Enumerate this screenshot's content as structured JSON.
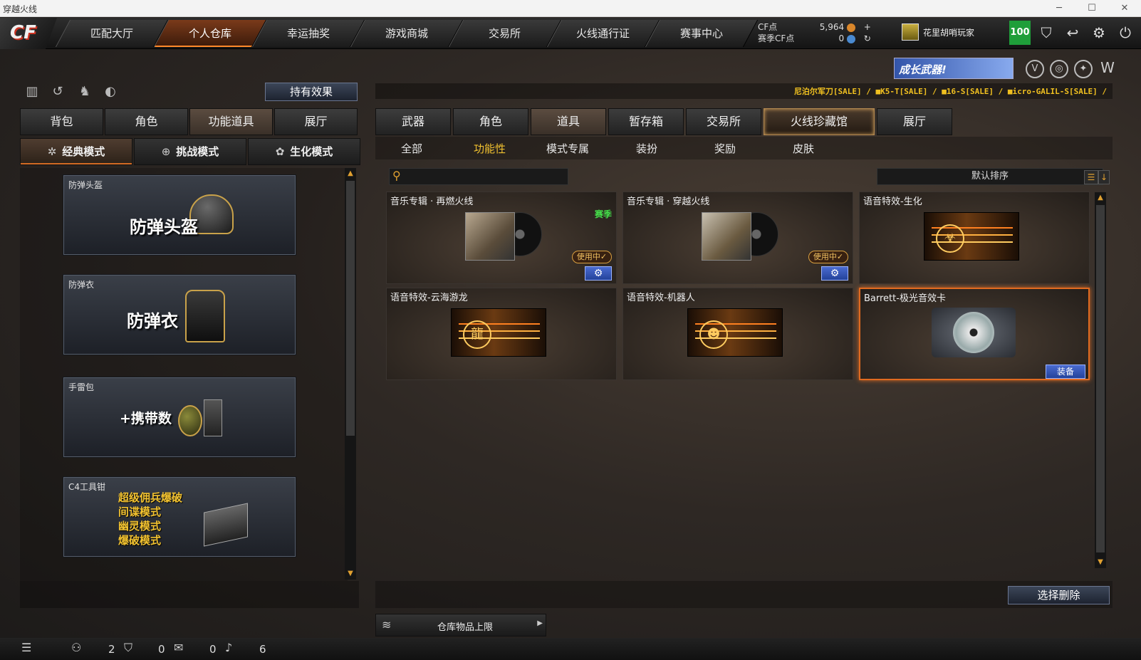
{
  "window": {
    "title": "穿越火线",
    "controls": [
      "─",
      "☐",
      "✕"
    ]
  },
  "nav": {
    "logo": "CF",
    "tabs": [
      "匹配大厅",
      "个人仓库",
      "幸运抽奖",
      "游戏商城",
      "交易所",
      "火线通行证",
      "赛事中心"
    ],
    "active": 1
  },
  "currency": {
    "cf_label": "CF点",
    "cf_value": "5,964",
    "season_label": "赛季CF点",
    "season_value": "0"
  },
  "player": {
    "name": "花里胡哨玩家",
    "level_badge": "100"
  },
  "promo": {
    "text": "成长武器!"
  },
  "left": {
    "effect_button": "持有效果",
    "tabs": [
      "背包",
      "角色",
      "功能道具",
      "展厅"
    ],
    "active_tab": 2,
    "modes": [
      "经典模式",
      "挑战模式",
      "生化模式"
    ],
    "active_mode": 0,
    "items": [
      {
        "label": "防弹头盔",
        "title": "防弹头盔"
      },
      {
        "label": "防弹衣",
        "title": "防弹衣"
      },
      {
        "label": "手雷包",
        "title": "+携带数"
      },
      {
        "label": "C4工具钳",
        "lines": [
          "超级佣兵爆破",
          "间谍模式",
          "幽灵模式",
          "爆破模式"
        ]
      }
    ]
  },
  "right": {
    "ticker": "尼泊尔军刀[SALE] / ■K5-T[SALE] / ■16-S[SALE] / ■icro-GALIL-S[SALE] /",
    "tabs": [
      "武器",
      "角色",
      "道具",
      "暂存箱",
      "交易所",
      "火线珍藏馆",
      "展厅"
    ],
    "active_tab": 2,
    "highlight_tab": 5,
    "subtabs": [
      "全部",
      "功能性",
      "模式专属",
      "装扮",
      "奖励",
      "皮肤"
    ],
    "active_subtab": 1,
    "search_placeholder": "",
    "sort_label": "默认排序",
    "items": [
      {
        "title": "音乐专辑 · 再燃火线",
        "tag": "赛季",
        "status": "使用中✓"
      },
      {
        "title": "音乐专辑 · 穿越火线",
        "status": "使用中✓"
      },
      {
        "title": "语音特效-生化"
      },
      {
        "title": "语音特效-云海游龙"
      },
      {
        "title": "语音特效-机器人"
      },
      {
        "title": "Barrett-极光音效卡",
        "action": "装备"
      }
    ],
    "delete_button": "选择删除",
    "capacity_label": "仓库物品上限"
  },
  "status": {
    "counts": [
      "2",
      "0",
      "0",
      "6"
    ]
  }
}
